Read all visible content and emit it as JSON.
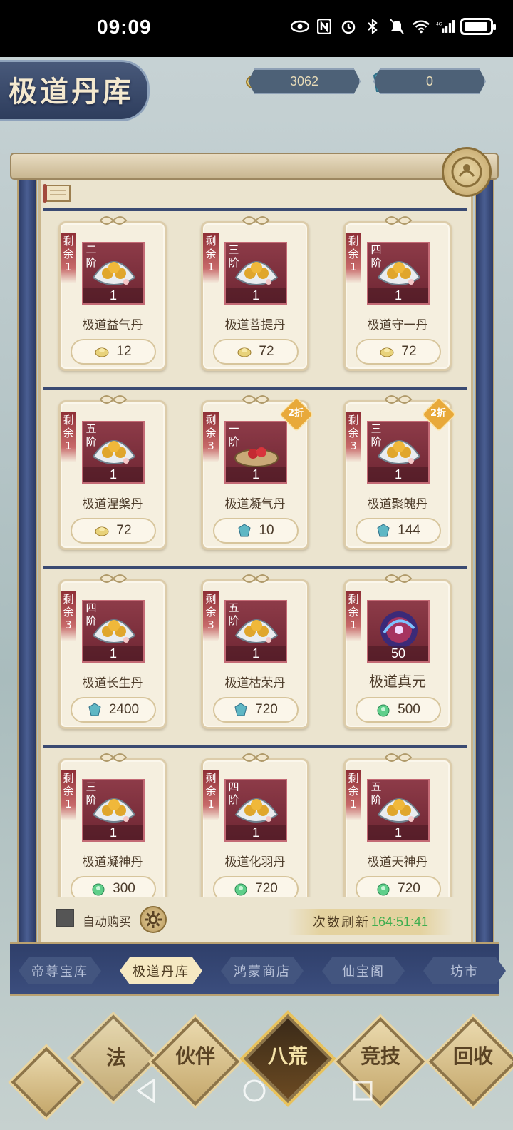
{
  "status_bar": {
    "time": "09:09"
  },
  "header": {
    "title": "极道丹库",
    "currency_gold": "3062",
    "currency_jade": "0"
  },
  "items": [
    {
      "remain_label": "剩余",
      "remain": "1",
      "grade": "二阶",
      "qty": "1",
      "name": "极道益气丹",
      "price": "12",
      "currency": "gold",
      "discount": ""
    },
    {
      "remain_label": "剩余",
      "remain": "1",
      "grade": "三阶",
      "qty": "1",
      "name": "极道菩提丹",
      "price": "72",
      "currency": "gold",
      "discount": ""
    },
    {
      "remain_label": "剩余",
      "remain": "1",
      "grade": "四阶",
      "qty": "1",
      "name": "极道守一丹",
      "price": "72",
      "currency": "gold",
      "discount": ""
    },
    {
      "remain_label": "剩余",
      "remain": "1",
      "grade": "五阶",
      "qty": "1",
      "name": "极道涅槃丹",
      "price": "72",
      "currency": "gold",
      "discount": ""
    },
    {
      "remain_label": "剩余",
      "remain": "3",
      "grade": "一阶",
      "qty": "1",
      "name": "极道凝气丹",
      "price": "10",
      "currency": "crystal",
      "discount": "2折"
    },
    {
      "remain_label": "剩余",
      "remain": "3",
      "grade": "三阶",
      "qty": "1",
      "name": "极道聚魄丹",
      "price": "144",
      "currency": "crystal",
      "discount": "2折"
    },
    {
      "remain_label": "剩余",
      "remain": "3",
      "grade": "四阶",
      "qty": "1",
      "name": "极道长生丹",
      "price": "2400",
      "currency": "crystal",
      "discount": ""
    },
    {
      "remain_label": "剩余",
      "remain": "3",
      "grade": "五阶",
      "qty": "1",
      "name": "极道枯荣丹",
      "price": "720",
      "currency": "crystal",
      "discount": ""
    },
    {
      "remain_label": "剩余",
      "remain": "1",
      "grade": "",
      "qty": "50",
      "name": "极道真元",
      "price": "500",
      "currency": "jade",
      "discount": ""
    },
    {
      "remain_label": "剩余",
      "remain": "1",
      "grade": "三阶",
      "qty": "1",
      "name": "极道凝神丹",
      "price": "300",
      "currency": "jade",
      "discount": ""
    },
    {
      "remain_label": "剩余",
      "remain": "1",
      "grade": "四阶",
      "qty": "1",
      "name": "极道化羽丹",
      "price": "720",
      "currency": "jade",
      "discount": ""
    },
    {
      "remain_label": "剩余",
      "remain": "1",
      "grade": "五阶",
      "qty": "1",
      "name": "极道天神丹",
      "price": "720",
      "currency": "jade",
      "discount": ""
    }
  ],
  "footer": {
    "auto_buy": "自动购买",
    "refresh_label": "次数刷新",
    "refresh_time": "164:51:41"
  },
  "tabs": [
    {
      "label": "帝尊宝库"
    },
    {
      "label": "极道丹库"
    },
    {
      "label": "鸿蒙商店"
    },
    {
      "label": "仙宝阁"
    },
    {
      "label": "坊市"
    }
  ],
  "active_tab": "极道丹库",
  "bottom_nav": [
    {
      "label": "法"
    },
    {
      "label": "伙伴"
    },
    {
      "label": "八荒"
    },
    {
      "label": "竞技"
    },
    {
      "label": "回收"
    }
  ]
}
